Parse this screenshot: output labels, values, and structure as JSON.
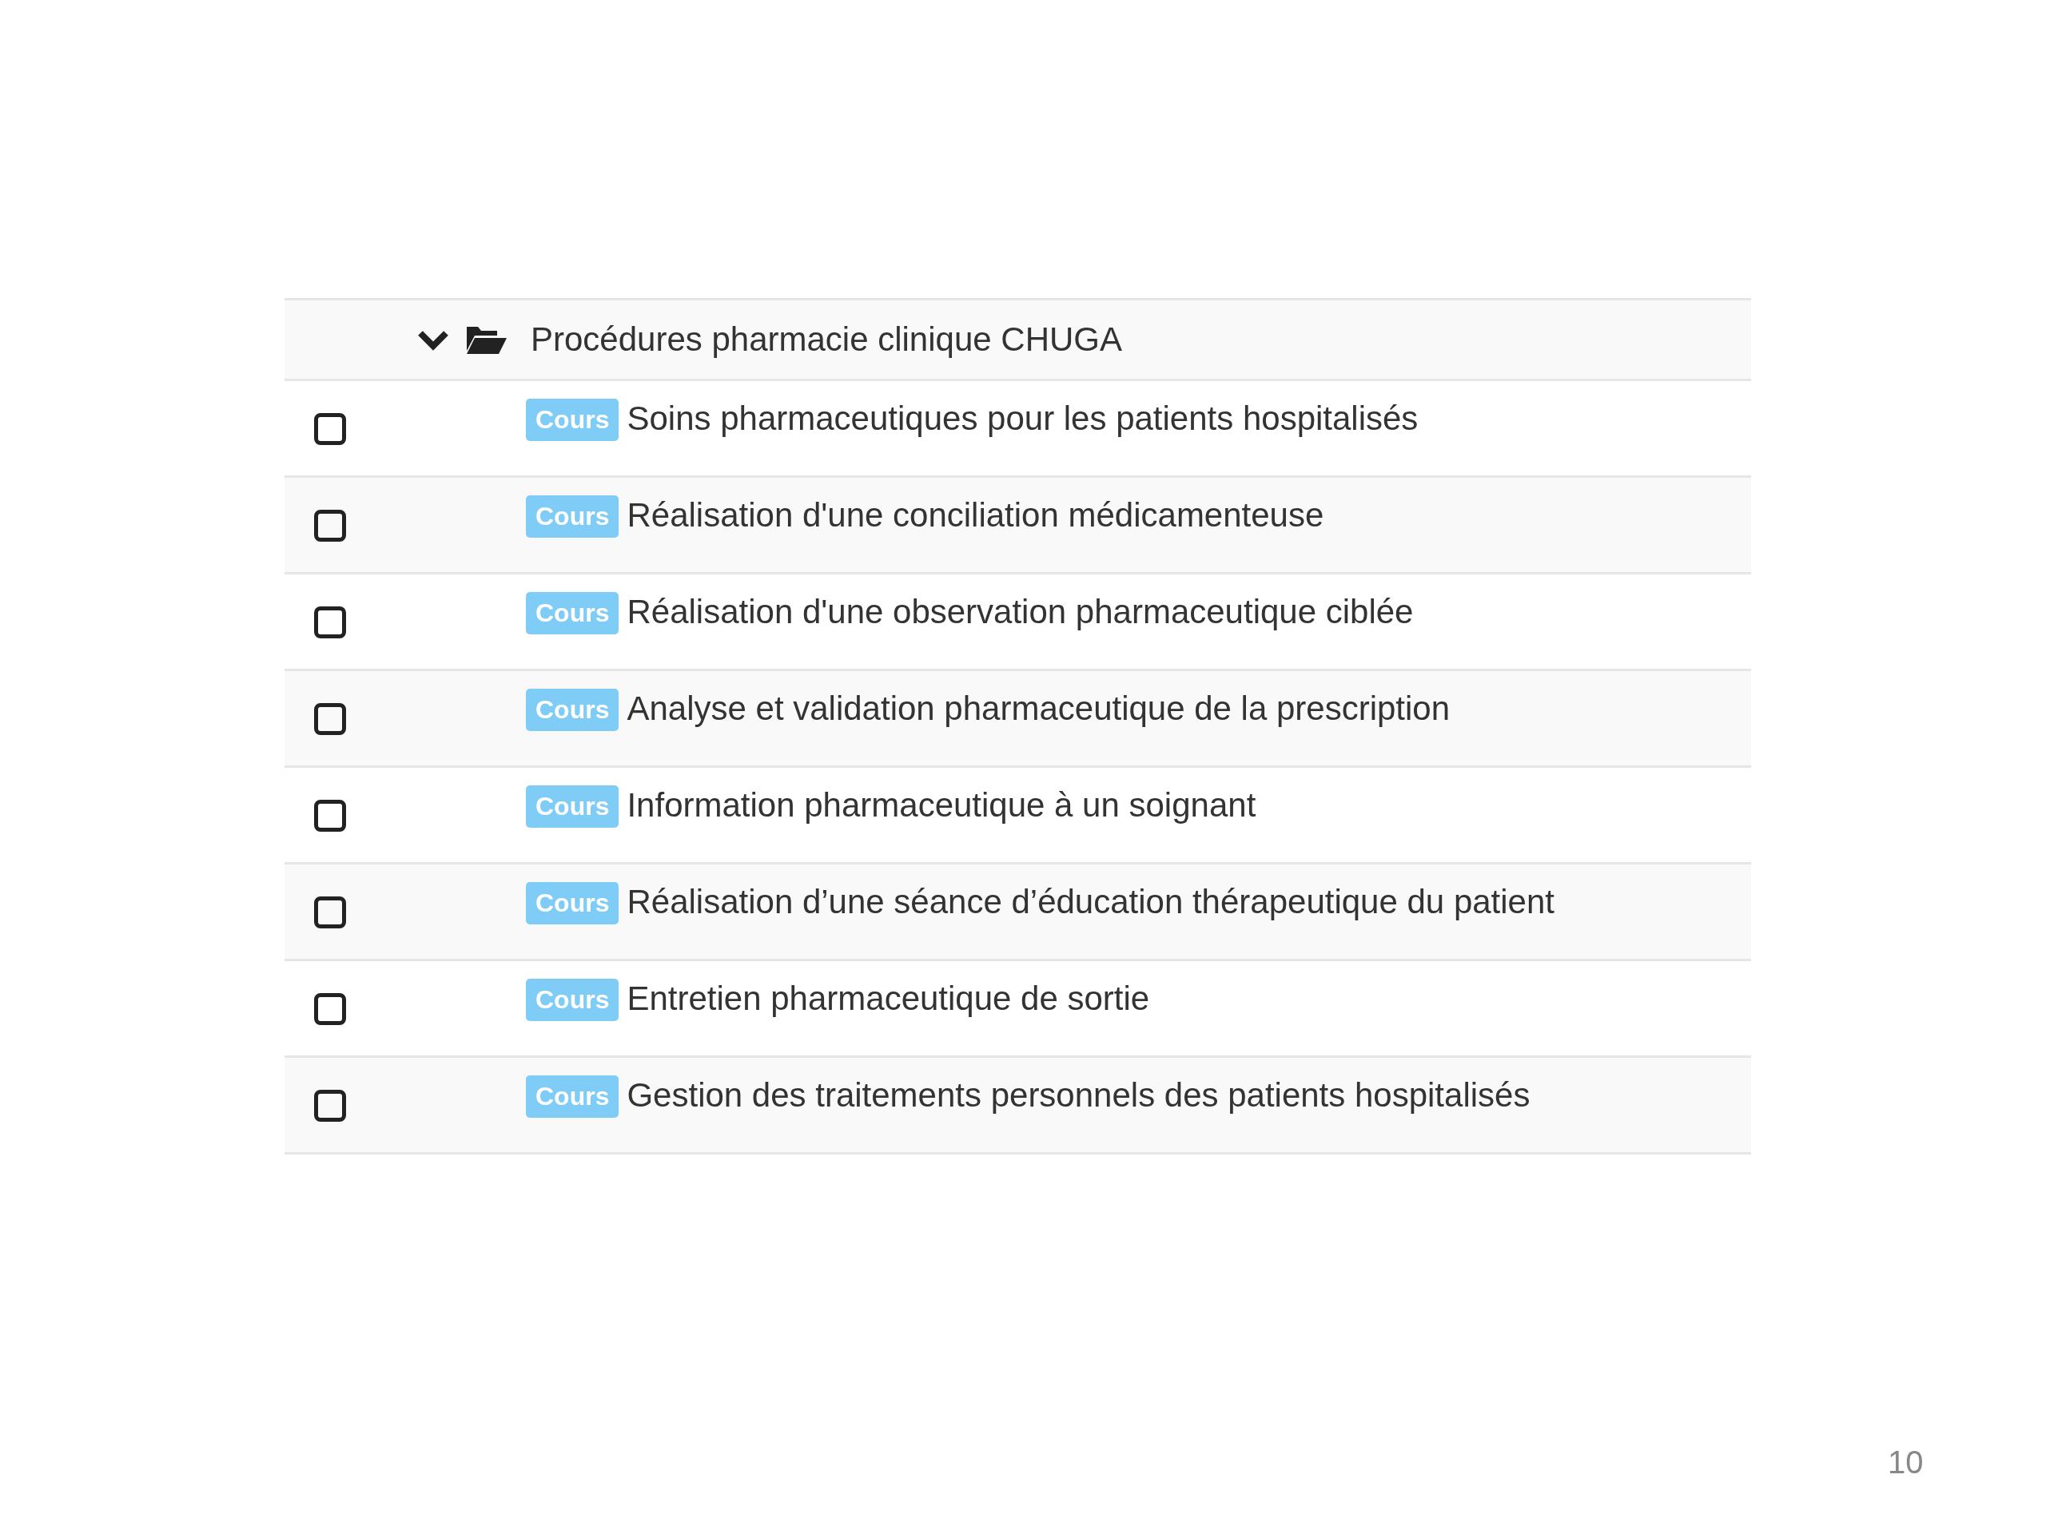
{
  "folder": {
    "title": "Procédures pharmacie clinique CHUGA",
    "expanded": true
  },
  "items": [
    {
      "badge": "Cours",
      "title": "Soins pharmaceutiques pour les patients hospitalisés",
      "checked": false
    },
    {
      "badge": "Cours",
      "title": "Réalisation d'une conciliation médicamenteuse",
      "checked": false
    },
    {
      "badge": "Cours",
      "title": "Réalisation d'une observation pharmaceutique ciblée",
      "checked": false
    },
    {
      "badge": "Cours",
      "title": "Analyse et validation pharmaceutique de la prescription",
      "checked": false
    },
    {
      "badge": "Cours",
      "title": "Information pharmaceutique à un soignant",
      "checked": false
    },
    {
      "badge": "Cours",
      "title": "Réalisation d’une séance d’éducation thérapeutique du patient",
      "checked": false
    },
    {
      "badge": "Cours",
      "title": "Entretien pharmaceutique de sortie",
      "checked": false
    },
    {
      "badge": "Cours",
      "title": "Gestion des traitements personnels des patients hospitalisés",
      "checked": false
    }
  ],
  "page_number": "10"
}
